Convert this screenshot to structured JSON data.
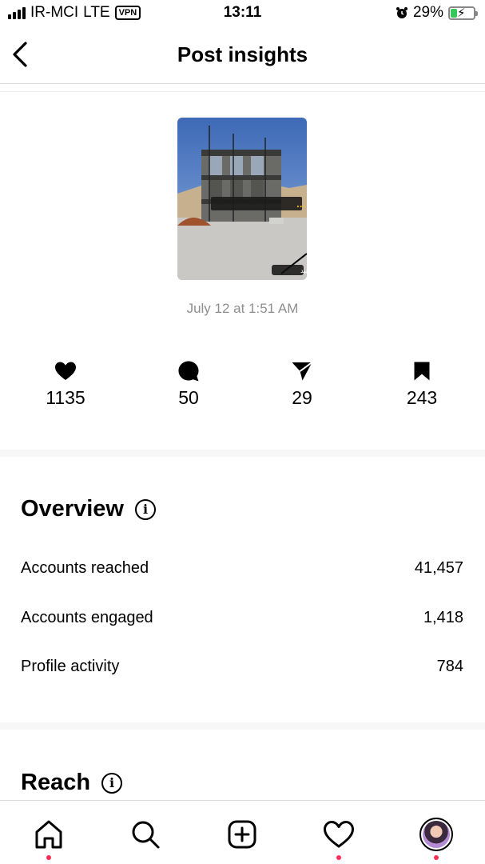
{
  "status_bar": {
    "carrier": "IR-MCI",
    "network": "LTE",
    "vpn": "VPN",
    "time": "13:11",
    "battery": "29%"
  },
  "header": {
    "title": "Post insights"
  },
  "post": {
    "image_caption": "اینجا یه کارگاه ساختمانیه ...",
    "swipe_label": "ورق بزنید",
    "date": "July 12 at 1:51 AM"
  },
  "stats": {
    "likes": "1135",
    "comments": "50",
    "shares": "29",
    "saves": "243"
  },
  "overview": {
    "title": "Overview",
    "rows": [
      {
        "label": "Accounts reached",
        "value": "41,457"
      },
      {
        "label": "Accounts engaged",
        "value": "1,418"
      },
      {
        "label": "Profile activity",
        "value": "784"
      }
    ]
  },
  "reach": {
    "title": "Reach"
  },
  "icons": {
    "back": "chevron-left-icon",
    "likes": "heart-icon",
    "comments": "comment-bubble-icon",
    "shares": "paper-plane-icon",
    "saves": "bookmark-icon",
    "info": "info-icon",
    "nav": [
      "home-icon",
      "search-icon",
      "plus-square-icon",
      "heart-outline-icon",
      "avatar"
    ]
  },
  "colors": {
    "notification_dot": "#ff2d55",
    "muted_text": "#8e8e8e",
    "battery_fill": "#35c759"
  }
}
